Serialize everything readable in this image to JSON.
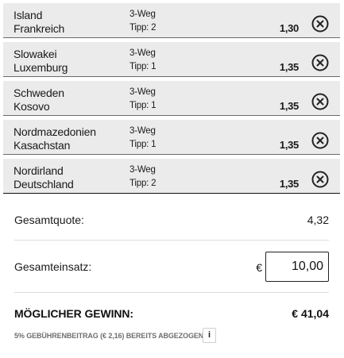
{
  "bets": [
    {
      "home": "Island",
      "away": "Frankreich",
      "market": "3-Weg",
      "tip": "Tipp: 2",
      "odds": "1,30"
    },
    {
      "home": "Slowakei",
      "away": "Luxemburg",
      "market": "3-Weg",
      "tip": "Tipp: 1",
      "odds": "1,35"
    },
    {
      "home": "Schweden",
      "away": "Kosovo",
      "market": "3-Weg",
      "tip": "Tipp: 1",
      "odds": "1,35"
    },
    {
      "home": "Nordmazedonien",
      "away": "Kasachstan",
      "market": "3-Weg",
      "tip": "Tipp: 1",
      "odds": "1,35"
    },
    {
      "home": "Nordirland",
      "away": "Deutschland",
      "market": "3-Weg",
      "tip": "Tipp: 2",
      "odds": "1,35"
    }
  ],
  "summary": {
    "total_odds_label": "Gesamtquote:",
    "total_odds_value": "4,32",
    "stake_label": "Gesamteinsatz:",
    "currency": "€",
    "stake_value": "10,00",
    "win_label": "MÖGLICHER GEWINN:",
    "win_value": "€ 41,04",
    "fee_note": "5% GEBÜHRENBEITRAG (€ 2,16) BEREITS ABGEZOGEN",
    "info_label": "i"
  },
  "icons": {
    "remove": "close-circle-icon"
  },
  "colors": {
    "row_background": "#ebebeb",
    "text": "#1a1a1a",
    "fee_note": "#6e6e6e"
  }
}
